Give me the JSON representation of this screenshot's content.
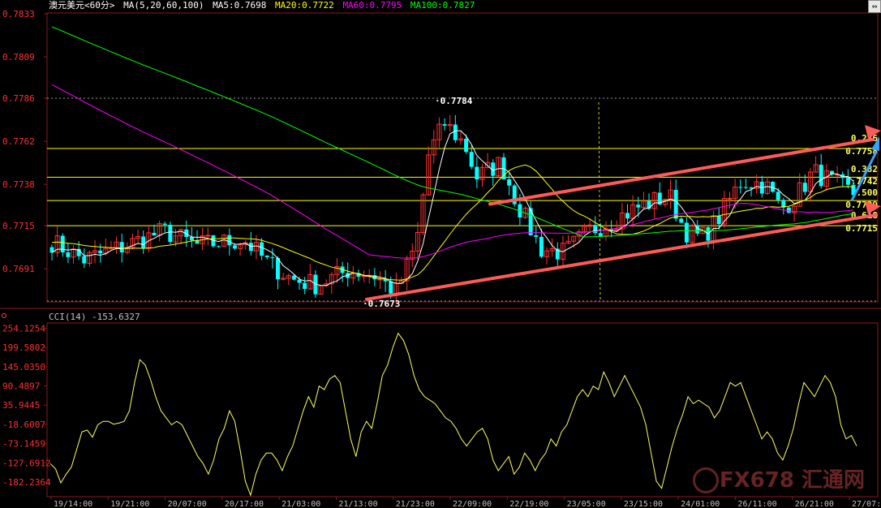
{
  "header": {
    "symbol": "澳元美元<60分>",
    "ma_spec": "MA(5,20,60,100)",
    "ma5": "MA5:0.7698",
    "ma20": "MA20:0.7722",
    "ma60": "MA60:0.7795",
    "ma100": "MA100:0.7827"
  },
  "cci_header": {
    "label": "CCI(14)",
    "value": "-153.6327"
  },
  "watermark": "FX678 汇通网",
  "colors": {
    "price_axis": "#ff3030",
    "fib": "#ffff00",
    "up": "#ff3030",
    "down": "#00ffff",
    "ma5": "#ffffff",
    "ma20": "#ffff00",
    "ma60": "#ff00ff",
    "ma100": "#00ff00",
    "trend": "#ff5a5a",
    "arrow_blue": "#3aa0ff",
    "cci": "#ffff60"
  },
  "chart_data": [
    {
      "type": "candlestick",
      "ylim": [
        0.7673,
        0.7833
      ],
      "y_ticks": [
        "0.7833",
        "0.7809",
        "0.7786",
        "0.7762",
        "0.7738",
        "0.7715",
        "0.7691"
      ],
      "x_ticks": [
        "19/14:00",
        "19/21:00",
        "20/07:00",
        "20/17:00",
        "21/03:00",
        "21/13:00",
        "21/23:00",
        "22/09:00",
        "22/19:00",
        "23/05:00",
        "23/15:00",
        "24/01:00",
        "26/11:00",
        "26/21:00",
        "27/07:00"
      ],
      "annotations": [
        "0.7784",
        "0.7673"
      ],
      "fib_lines": [
        {
          "label": "0.236",
          "price": "0.7758"
        },
        {
          "label": "0.382",
          "price": "0.7742"
        },
        {
          "label": "0.500",
          "price": "0.7729"
        },
        {
          "label": "0.618",
          "price": "0.7715"
        }
      ],
      "right_labels": [
        "0.236",
        "0.7758",
        "0.382",
        "0.7742",
        "0.500",
        "0.7729",
        "0.618",
        "0.7715"
      ],
      "candles": [],
      "series_names": []
    },
    {
      "type": "line",
      "title": "CCI(14)",
      "ylim": [
        -210,
        260
      ],
      "y_ticks": [
        "254.1254",
        "199.5802",
        "145.0350",
        "90.4897",
        "35.9445",
        "-18.6007",
        "-73.1459",
        "-127.6912",
        "-182.2364"
      ],
      "values": [
        -130,
        -145,
        -185,
        -160,
        -140,
        -90,
        -40,
        -35,
        -55,
        -20,
        -10,
        -10,
        -18,
        -15,
        -10,
        20,
        100,
        165,
        150,
        110,
        60,
        20,
        0,
        -20,
        -10,
        -20,
        -50,
        -80,
        -110,
        -130,
        -160,
        -120,
        -60,
        -30,
        20,
        -10,
        -90,
        -180,
        -220,
        -160,
        -120,
        -100,
        -100,
        -120,
        -150,
        -110,
        -80,
        -30,
        20,
        60,
        30,
        90,
        80,
        110,
        120,
        100,
        20,
        -60,
        -110,
        -40,
        -10,
        -30,
        40,
        120,
        150,
        200,
        240,
        220,
        180,
        120,
        80,
        60,
        50,
        40,
        20,
        0,
        -10,
        -30,
        -60,
        -80,
        -60,
        -40,
        -30,
        -60,
        -120,
        -150,
        -130,
        -110,
        -160,
        -140,
        -100,
        -120,
        -150,
        -120,
        -100,
        -60,
        -80,
        -40,
        -20,
        20,
        60,
        80,
        60,
        90,
        80,
        130,
        100,
        60,
        90,
        120,
        90,
        60,
        30,
        -20,
        -100,
        -180,
        -200,
        -140,
        -80,
        -30,
        10,
        60,
        40,
        50,
        40,
        30,
        0,
        20,
        60,
        100,
        90,
        100,
        60,
        20,
        -20,
        -60,
        -40,
        -60,
        -100,
        -120,
        -80,
        -30,
        40,
        100,
        80,
        60,
        90,
        120,
        100,
        60,
        -20,
        -60,
        -50,
        -80
      ]
    }
  ]
}
